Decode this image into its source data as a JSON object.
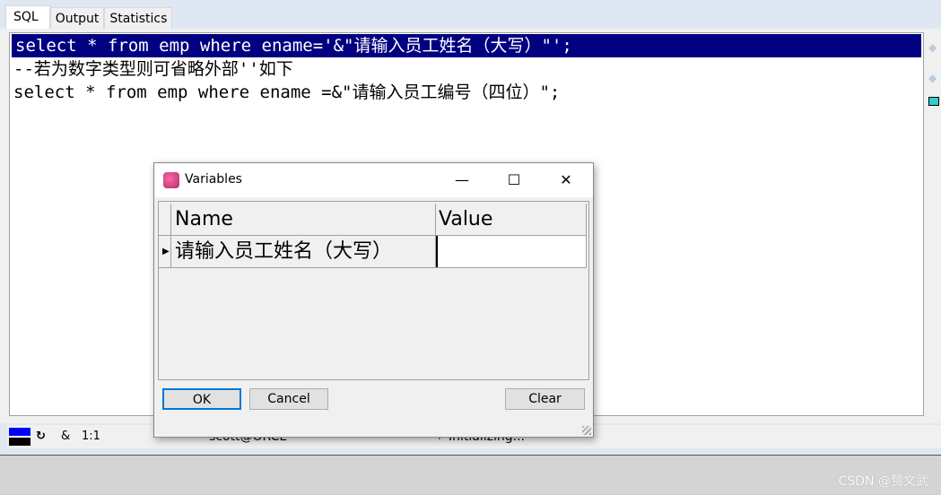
{
  "tabs": [
    {
      "label": "SQL"
    },
    {
      "label": "Output"
    },
    {
      "label": "Statistics"
    }
  ],
  "editor": {
    "lines": [
      "select * from emp where ename='&\"请输入员工姓名（大写）\"';",
      "--若为数字类型则可省略外部''如下",
      "select * from emp where ename =&\"请输入员工编号（四位）\";"
    ]
  },
  "status": {
    "amp": "&",
    "position": "1:1",
    "connection": "scott@ORCL",
    "message": "Initializing..."
  },
  "dialog": {
    "title": "Variables",
    "columns": [
      "Name",
      "Value"
    ],
    "rows": [
      {
        "name": "请输入员工姓名（大写）",
        "value": ""
      }
    ],
    "ok": "OK",
    "cancel": "Cancel",
    "clear": "Clear"
  },
  "watermark": "CSDN @赟文武",
  "colors": {
    "selection": "#000080",
    "default_button_border": "#0078d7"
  }
}
